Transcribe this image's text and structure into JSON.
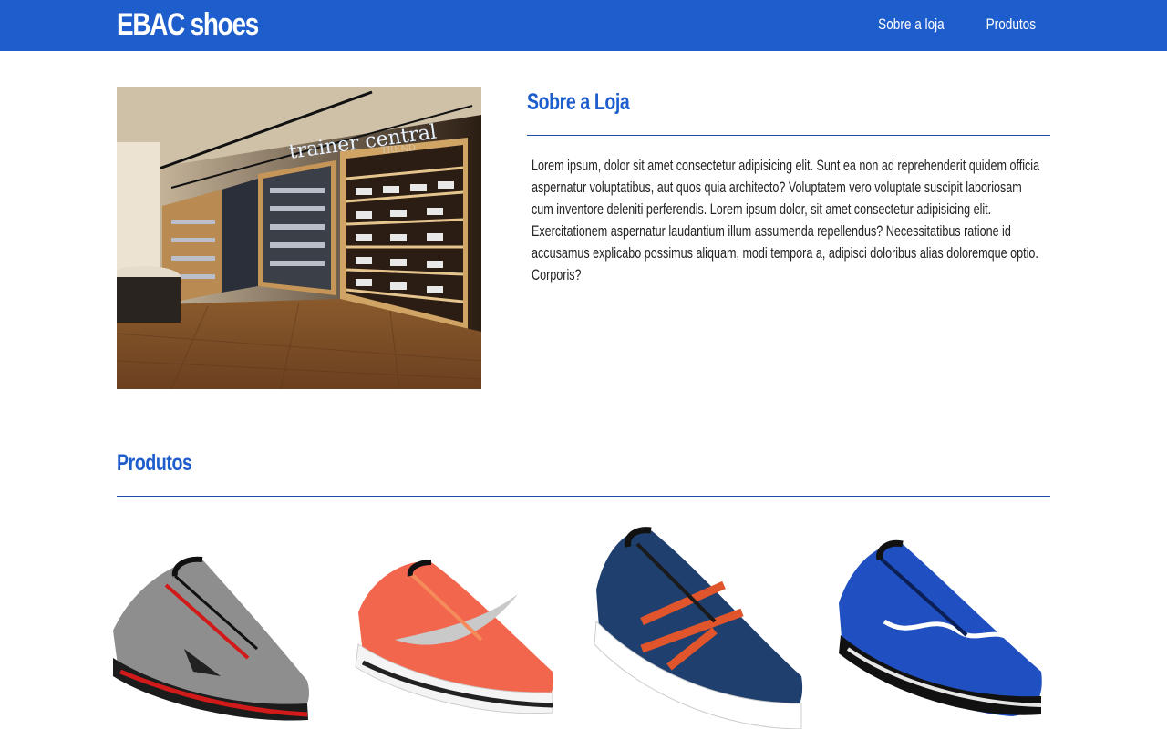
{
  "header": {
    "brand": "EBAC shoes",
    "nav": [
      {
        "label": "Sobre a loja"
      },
      {
        "label": "Produtos"
      }
    ]
  },
  "about": {
    "title": "Sobre a Loja",
    "text": "Lorem ipsum, dolor sit amet consectetur adipisicing elit. Sunt ea non ad reprehenderit quidem officia aspernatur voluptatibus, aut quos quia architecto? Voluptatem vero voluptate suscipit laboriosam cum inventore deleniti perferendis. Lorem ipsum dolor, sit amet consectetur adipisicing elit. Exercitationem aspernatur laudantium illum assumenda repellendus? Necessitatibus ratione id accusamus explicabo possimus aliquam, modi tempora a, adipisci doloribus alias doloremque optio. Corporis?",
    "photo_sign": "trainer central",
    "photo_subsign": "TREND"
  },
  "products": {
    "title": "Produtos",
    "items": [
      {
        "icon": "mizuno-grey-shoe",
        "color": "#9a9a9a",
        "accent": "#d11a1a"
      },
      {
        "icon": "nike-coral-shoe",
        "color": "#f2664e",
        "accent": "#c9c9c9"
      },
      {
        "icon": "asics-navy-shoe",
        "color": "#1f3f6e",
        "accent": "#e0552b"
      },
      {
        "icon": "mizuno-blue-shoe",
        "color": "#1f4fc0",
        "accent": "#ffffff"
      }
    ]
  },
  "colors": {
    "primary": "#1e5dcc",
    "text": "#222222"
  }
}
